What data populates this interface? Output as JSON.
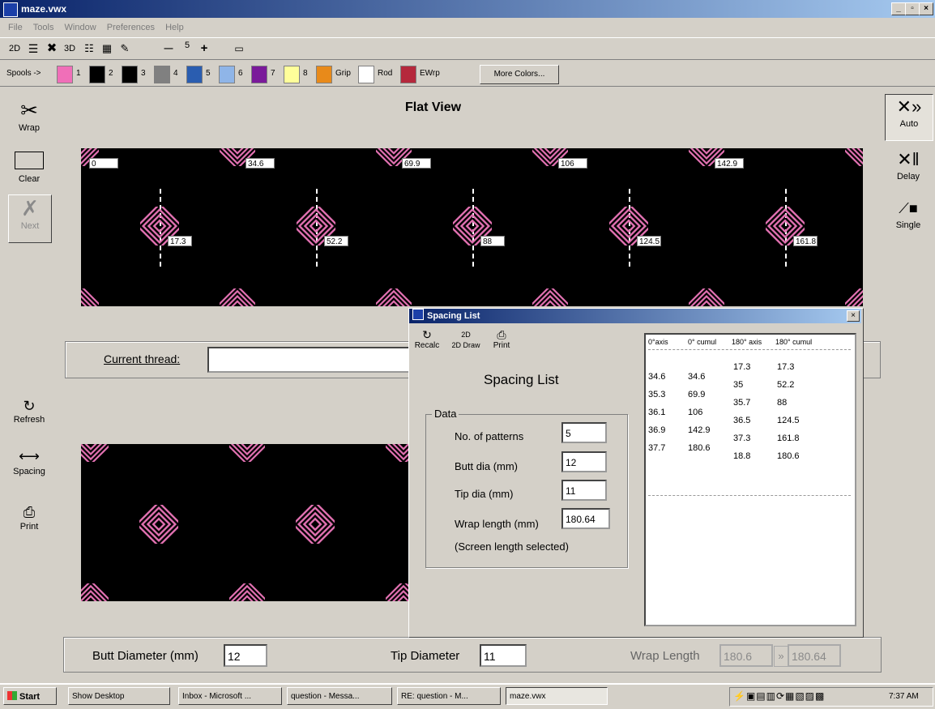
{
  "window": {
    "title": "maze.vwx",
    "min": "_",
    "max": "▫",
    "close": "×"
  },
  "menu": [
    "File",
    "Tools",
    "Window",
    "Preferences",
    "Help"
  ],
  "toolbar": {
    "two_d": "2D",
    "three_d": "3D",
    "minus": "—",
    "value": "5",
    "plus": "+"
  },
  "colorbar": {
    "label": "Spools ->",
    "swatches": [
      {
        "num": "1",
        "color": "#f06fb8"
      },
      {
        "num": "2",
        "color": "#000000"
      },
      {
        "num": "3",
        "color": "#000000"
      },
      {
        "num": "4",
        "color": "#808080"
      },
      {
        "num": "5",
        "color": "#2a5db0"
      },
      {
        "num": "6",
        "color": "#8fb5e8"
      },
      {
        "num": "7",
        "color": "#7a1a9a"
      },
      {
        "num": "8",
        "color": "#ffff9a"
      },
      {
        "num": "Grip",
        "color": "#e88a1a"
      },
      {
        "num": "Rod",
        "color": "#ffffff"
      },
      {
        "num": "EWrp",
        "color": "#b5283c"
      }
    ],
    "more": "More Colors..."
  },
  "left_tools": {
    "wrap": "Wrap",
    "clear": "Clear",
    "next": "Next",
    "refresh": "Refresh",
    "spacing": "Spacing",
    "print": "Print"
  },
  "right_tools": {
    "auto": "Auto",
    "delay": "Delay",
    "single": "Single"
  },
  "flat_view": {
    "title": "Flat View",
    "top_labels": [
      "0",
      "34.6",
      "69.9",
      "106",
      "142.9"
    ],
    "mid_labels": [
      "17.3",
      "52.2",
      "88",
      "124.5",
      "161.8"
    ],
    "motif_color": "#e070b0"
  },
  "thread": {
    "label": "Current thread:",
    "value": ""
  },
  "bottom_bar": {
    "butt_label": "Butt Diameter (mm)",
    "butt_value": "12",
    "tip_label": "Tip Diameter",
    "tip_value": "11",
    "wrap_label": "Wrap Length",
    "wrap_value1": "180.6",
    "arrow": "»",
    "wrap_value2": "180.64"
  },
  "dialog": {
    "title": "Spacing List",
    "close": "×",
    "tools": {
      "recalc": "Recalc",
      "draw": "2D Draw",
      "print": "Print"
    },
    "heading": "Spacing List",
    "group": "Data",
    "fields": [
      {
        "label": "No. of patterns",
        "value": "5"
      },
      {
        "label": "Butt dia (mm)",
        "value": "12"
      },
      {
        "label": "Tip dia (mm)",
        "value": "11"
      },
      {
        "label": "Wrap length (mm)",
        "value": "180.64"
      }
    ],
    "note": "(Screen length selected)",
    "list": {
      "headers": [
        "0°axis",
        "0° cumul",
        "180° axis",
        "180° cumul"
      ],
      "col1": [
        "34.6",
        "35.3",
        "36.1",
        "36.9",
        "37.7"
      ],
      "col2": [
        "34.6",
        "69.9",
        "106",
        "142.9",
        "180.6"
      ],
      "col3": [
        "17.3",
        "35",
        "35.7",
        "36.5",
        "37.3",
        "18.8"
      ],
      "col4": [
        "17.3",
        "52.2",
        "88",
        "124.5",
        "161.8",
        "180.6"
      ]
    }
  },
  "taskbar": {
    "start": "Start",
    "buttons": [
      "Show Desktop",
      "Inbox - Microsoft ...",
      "question - Messa...",
      "RE: question - M...",
      "maze.vwx"
    ],
    "time": "7:37 AM"
  }
}
